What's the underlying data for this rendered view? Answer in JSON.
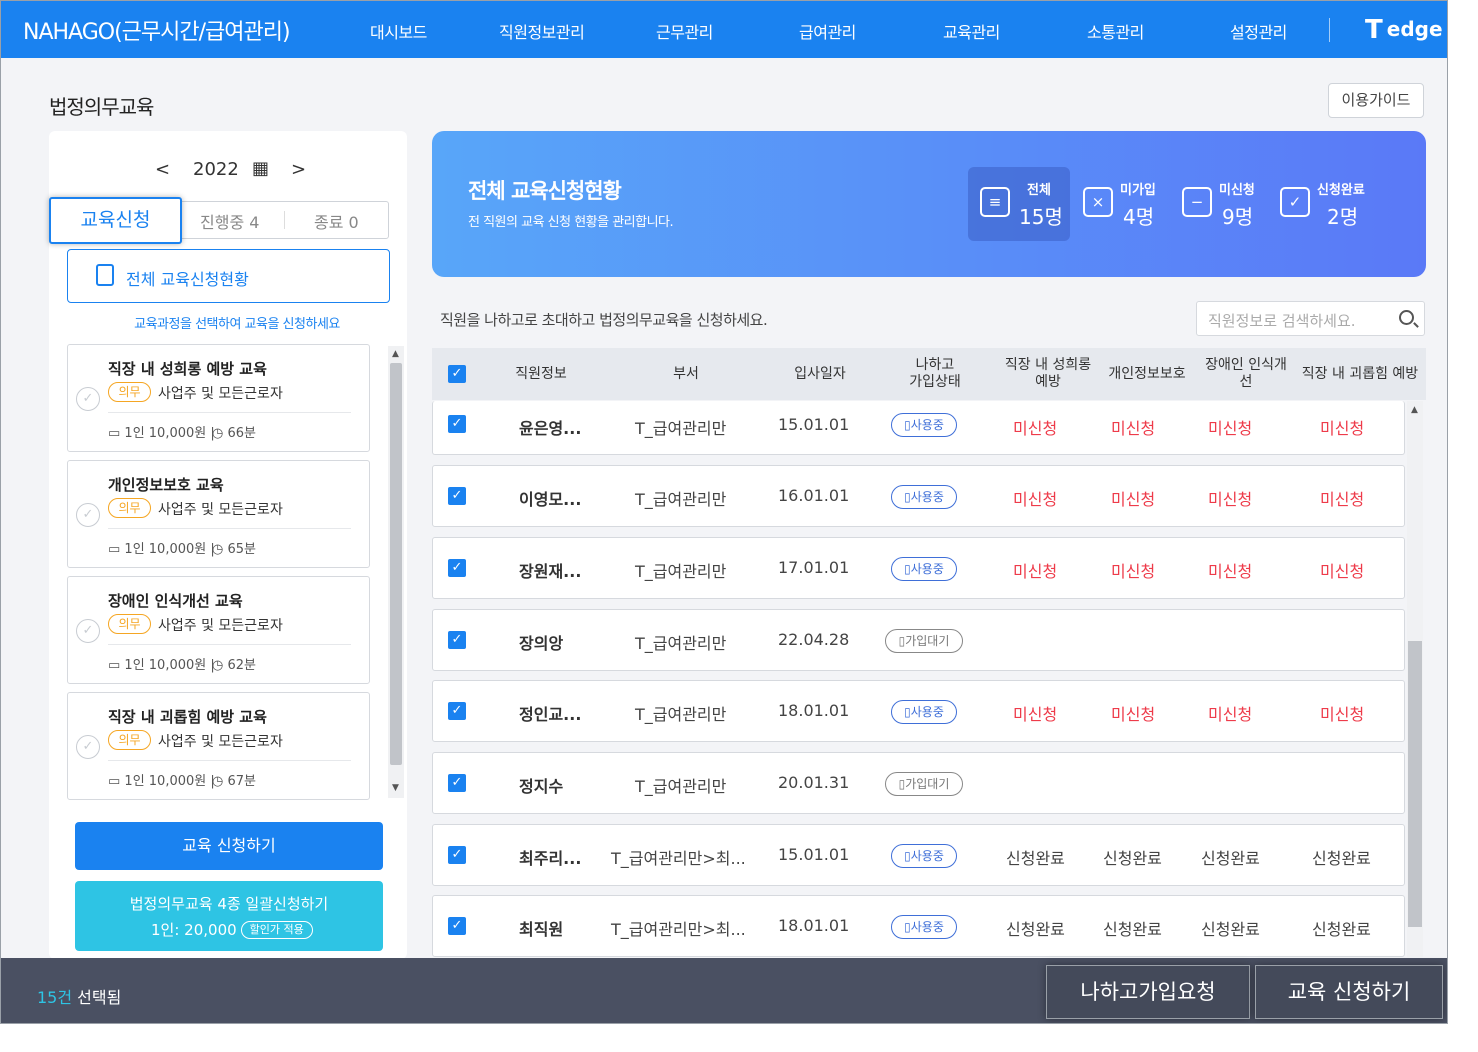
{
  "header": {
    "brand": "NAHAGO(근무시간/급여관리)",
    "nav": [
      "대시보드",
      "직원정보관리",
      "근무관리",
      "급여관리",
      "교육관리",
      "소통관리",
      "설정관리"
    ],
    "logo_t": "T",
    "logo_text": "edge"
  },
  "page": {
    "title": "법정의무교육",
    "guide_label": "이용가이드"
  },
  "left": {
    "year": "2022",
    "prev": "<",
    "next": ">",
    "calendar_icon": "▦",
    "tabs": {
      "apply": "교육신청",
      "ongoing": "진행중 4",
      "done": "종료 0"
    },
    "all_button": "전체 교육신청현황",
    "hint": "교육과정을 선택하여 교육을 신청하세요",
    "courses": [
      {
        "title": "직장 내 성희롱 예방 교육",
        "badge": "의무",
        "target": "사업주 및 모든근로자",
        "price": "1인 10,000원",
        "time": "66분"
      },
      {
        "title": "개인정보보호 교육",
        "badge": "의무",
        "target": "사업주 및 모든근로자",
        "price": "1인 10,000원",
        "time": "65분"
      },
      {
        "title": "장애인 인식개선 교육",
        "badge": "의무",
        "target": "사업주 및 모든근로자",
        "price": "1인 10,000원",
        "time": "62분"
      },
      {
        "title": "직장 내 괴롭힘 예방 교육",
        "badge": "의무",
        "target": "사업주 및 모든근로자",
        "price": "1인 10,000원",
        "time": "67분"
      }
    ],
    "apply_button": "교육 신청하기",
    "bulk": {
      "line1": "법정의무교육 4종 일괄신청하기",
      "line2": "1인: 20,000",
      "discount": "할인가 적용"
    }
  },
  "banner": {
    "title": "전체 교육신청현황",
    "subtitle": "전 직원의 교육 신청 현황을 관리합니다.",
    "stats": [
      {
        "label": "전체",
        "value": "15명",
        "icon": "list-icon"
      },
      {
        "label": "미가입",
        "value": "4명",
        "icon": "x-box-icon"
      },
      {
        "label": "미신청",
        "value": "9명",
        "icon": "minus-box-icon"
      },
      {
        "label": "신청완료",
        "value": "2명",
        "icon": "check-box-icon"
      }
    ]
  },
  "table": {
    "invite_text": "직원을 나하고로 초대하고 법정의무교육을 신청하세요.",
    "search_placeholder": "직원정보로 검색하세요.",
    "headers": [
      "직원정보",
      "부서",
      "입사일자",
      "나하고\n가입상태",
      "직장 내 성희롱\n예방",
      "개인정보보호",
      "장애인 인식개\n선",
      "직장 내 괴롭힘 예방"
    ],
    "rows": [
      {
        "name": "윤은영...",
        "dept": "T_급여관리만",
        "date": "15.01.01",
        "status": "사용중",
        "c1": "미신청",
        "c2": "미신청",
        "c3": "미신청",
        "c4": "미신청"
      },
      {
        "name": "이영모...",
        "dept": "T_급여관리만",
        "date": "16.01.01",
        "status": "사용중",
        "c1": "미신청",
        "c2": "미신청",
        "c3": "미신청",
        "c4": "미신청"
      },
      {
        "name": "장원재...",
        "dept": "T_급여관리만",
        "date": "17.01.01",
        "status": "사용중",
        "c1": "미신청",
        "c2": "미신청",
        "c3": "미신청",
        "c4": "미신청"
      },
      {
        "name": "장의앙",
        "dept": "T_급여관리만",
        "date": "22.04.28",
        "status": "가입대기",
        "c1": "",
        "c2": "",
        "c3": "",
        "c4": ""
      },
      {
        "name": "정인교...",
        "dept": "T_급여관리만",
        "date": "18.01.01",
        "status": "사용중",
        "c1": "미신청",
        "c2": "미신청",
        "c3": "미신청",
        "c4": "미신청"
      },
      {
        "name": "정지수",
        "dept": "T_급여관리만",
        "date": "20.01.31",
        "status": "가입대기",
        "c1": "",
        "c2": "",
        "c3": "",
        "c4": ""
      },
      {
        "name": "최주리...",
        "dept": "T_급여관리만>최...",
        "date": "15.01.01",
        "status": "사용중",
        "c1": "신청완료",
        "c2": "신청완료",
        "c3": "신청완료",
        "c4": "신청완료"
      },
      {
        "name": "최직원",
        "dept": "T_급여관리만>최...",
        "date": "18.01.01",
        "status": "사용중",
        "c1": "신청완료",
        "c2": "신청완료",
        "c3": "신청완료",
        "c4": "신청완료"
      }
    ]
  },
  "bottom": {
    "count": "15건",
    "count_suffix": " 선택됨",
    "invite_button": "나하고가입요청",
    "apply_button": "교육 신청하기"
  },
  "colors": {
    "primary": "#1a82f0",
    "cyan": "#2ec4e4",
    "red": "#ee3b4a",
    "bar": "#4a5062"
  }
}
